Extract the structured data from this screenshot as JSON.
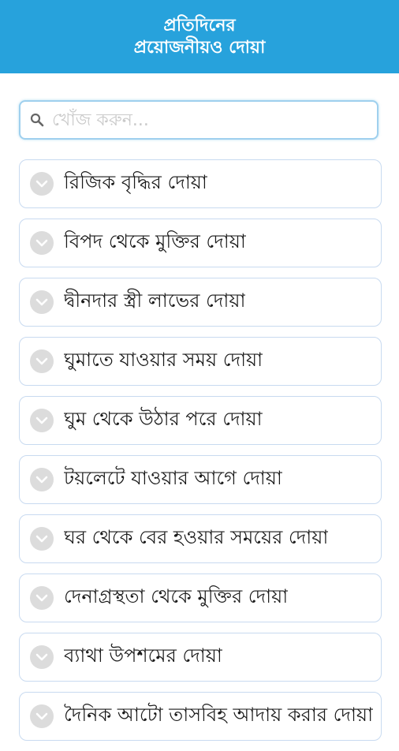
{
  "header": {
    "title_line1": "প্রতিদিনের",
    "title_line2": "প্রয়োজনীয়ও দোয়া",
    "background": "#27a2dc"
  },
  "search": {
    "icon": "search-icon",
    "placeholder": "খোঁজ করুন...",
    "value": ""
  },
  "items": [
    {
      "label": "রিজিক বৃদ্ধির দোয়া"
    },
    {
      "label": "বিপদ থেকে মুক্তির দোয়া"
    },
    {
      "label": "দ্বীনদার স্ত্রী লাভের দোয়া"
    },
    {
      "label": "ঘুমাতে যাওয়ার সময় দোয়া"
    },
    {
      "label": "ঘুম থেকে উঠার পরে দোয়া"
    },
    {
      "label": "টয়লেটে যাওয়ার আগে দোয়া"
    },
    {
      "label": "ঘর থেকে বের হওয়ার সময়ের দোয়া"
    },
    {
      "label": "দেনাগ্রস্থতা থেকে মুক্তির দোয়া"
    },
    {
      "label": "ব্যাথা উপশমের দোয়া"
    },
    {
      "label": "দৈনিক আটো তাসবিহ আদায় করার দোয়া"
    }
  ],
  "item_icon": "chevron-down-icon"
}
